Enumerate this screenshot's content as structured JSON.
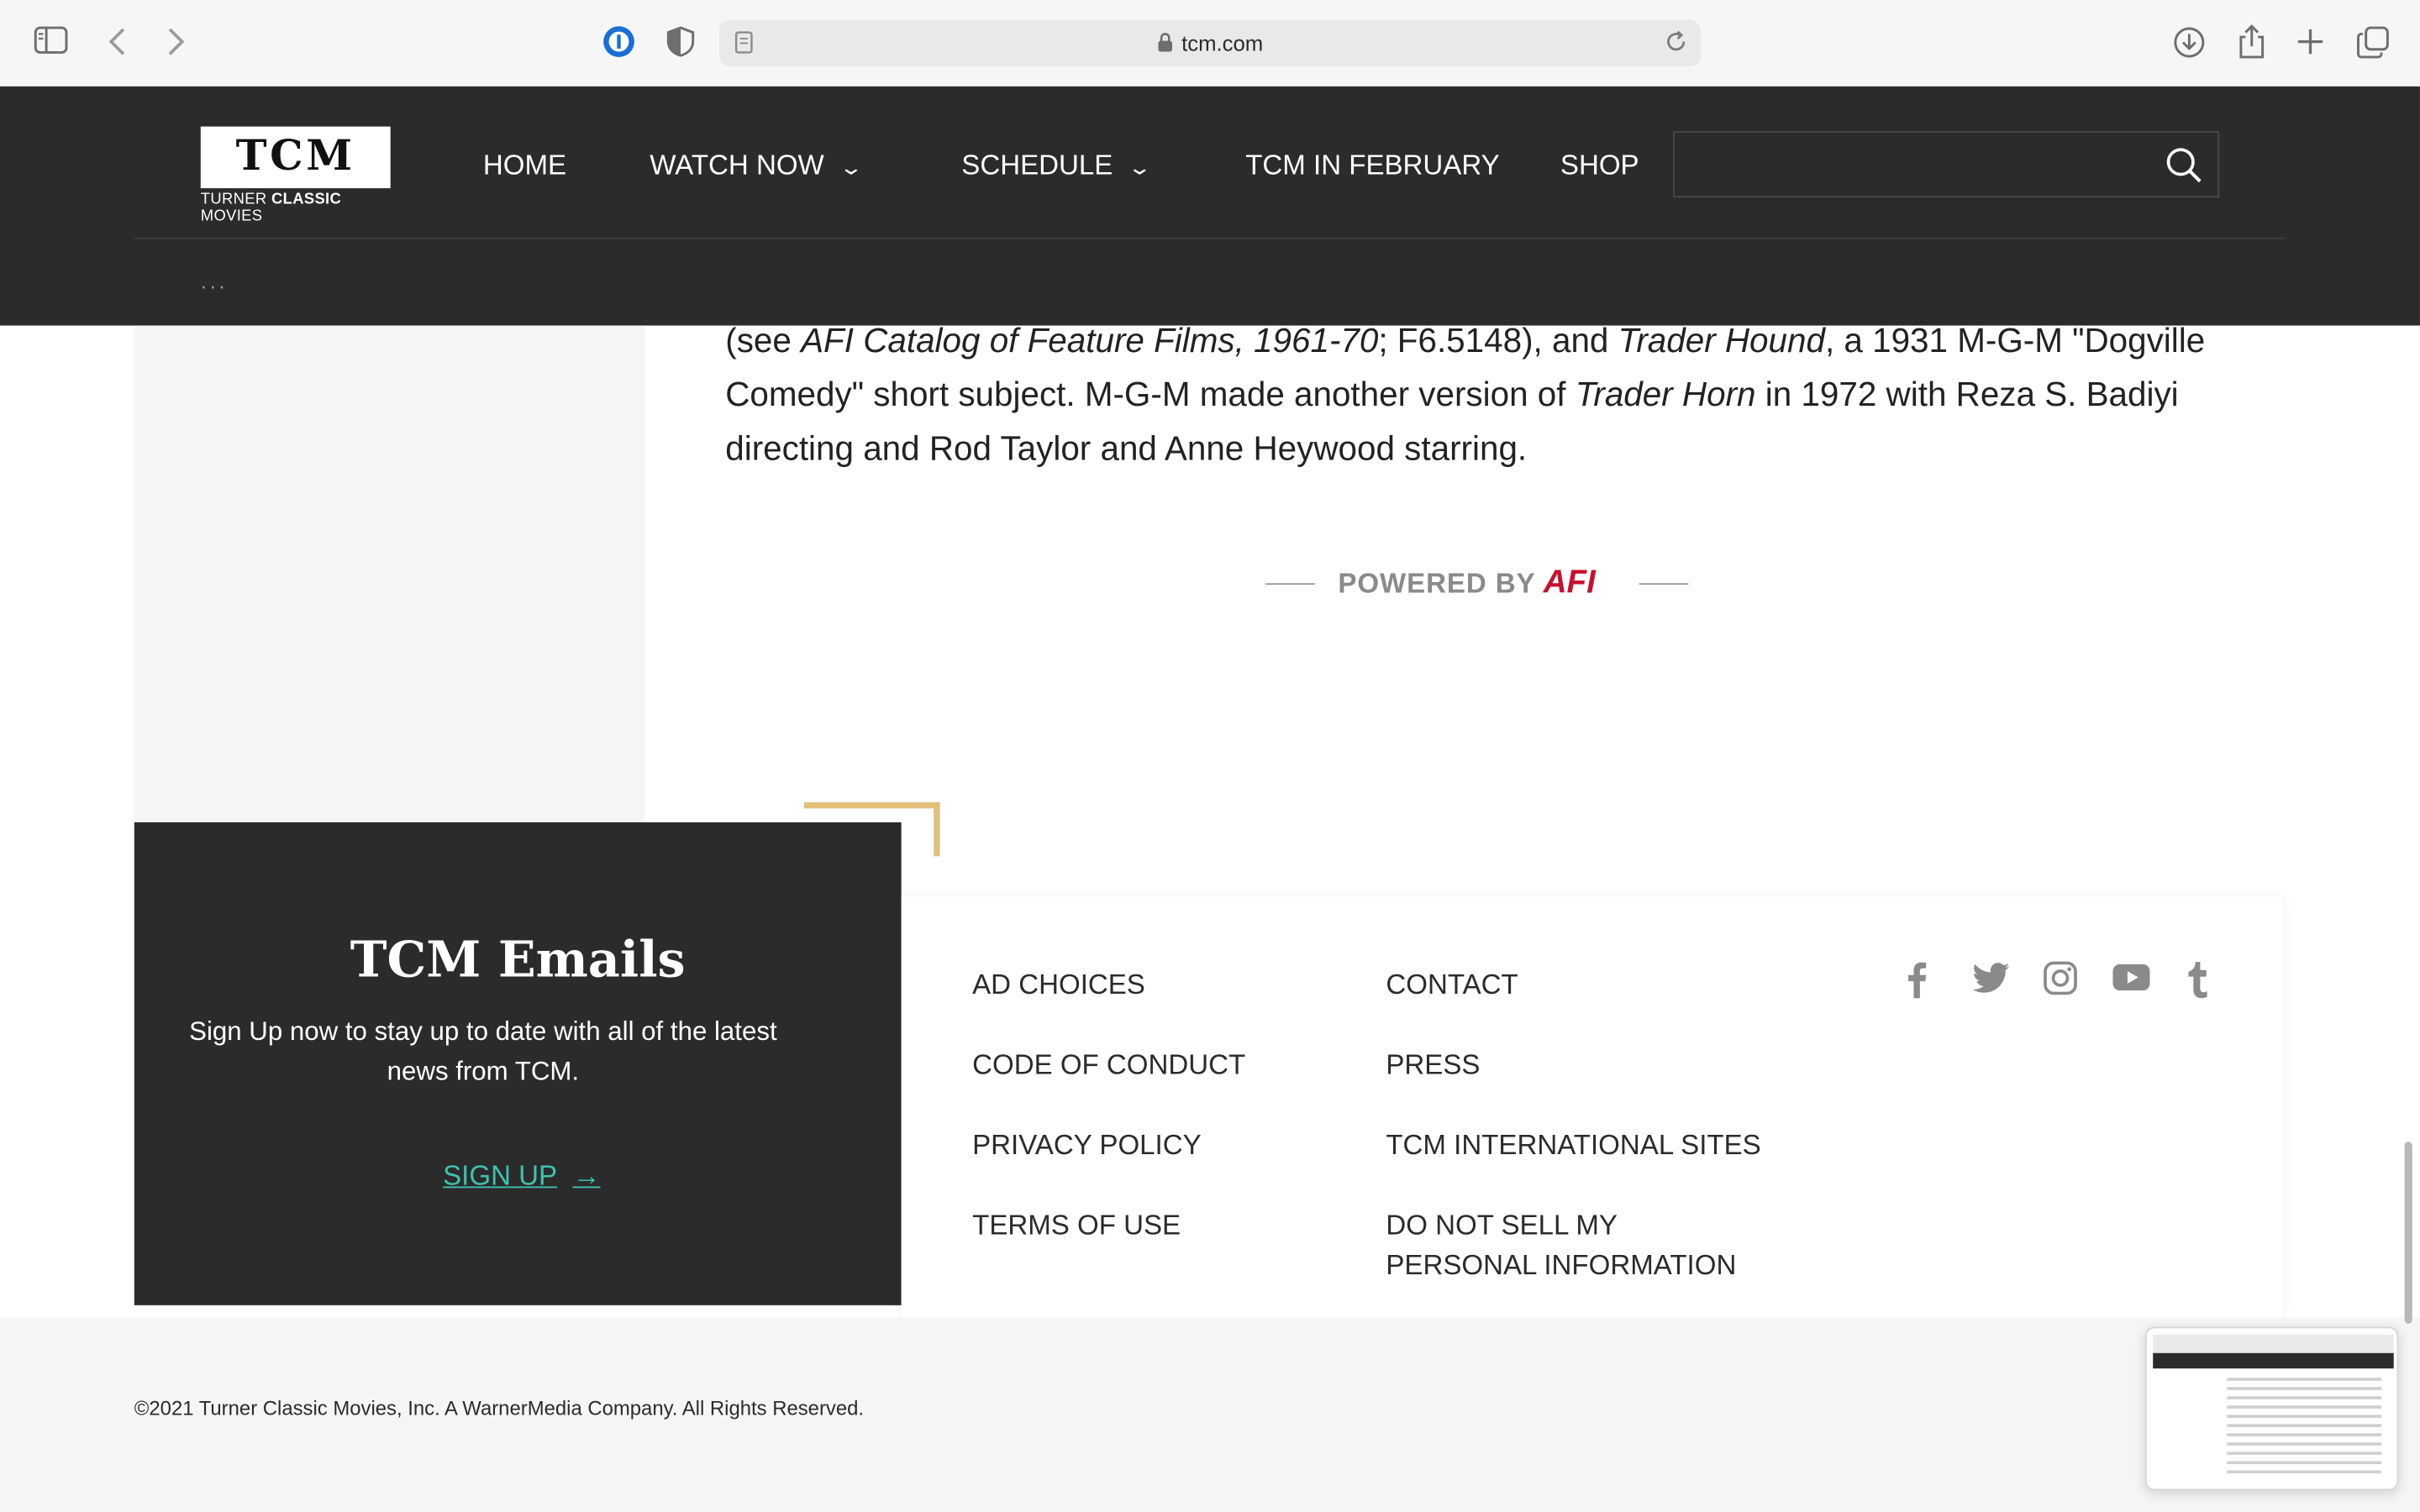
{
  "browser": {
    "url": "tcm.com",
    "icons": [
      "sidebar-icon",
      "back-icon",
      "forward-icon",
      "password-manager-icon",
      "shield-icon",
      "reader-icon",
      "lock-icon",
      "reload-icon",
      "download-icon",
      "share-icon",
      "new-tab-icon",
      "tabs-overview-icon"
    ]
  },
  "header": {
    "logo_text": "TCM",
    "logo_sub_prefix": "TURNER ",
    "logo_sub_bold": "CLASSIC",
    "logo_sub_suffix": " MOVIES",
    "nav": {
      "home": "HOME",
      "watch_now": "WATCH NOW",
      "schedule": "SCHEDULE",
      "tcm_in_february": "TCM IN FEBRUARY",
      "shop": "SHOP"
    },
    "search_value": "",
    "breadcrumb": "..."
  },
  "article": {
    "p1": "(see ",
    "p1_i1": "AFI Catalog of Feature Films, 1961-70",
    "p1_2": "; F6.5148), and ",
    "p1_i2": "Trader Hound",
    "p1_3": ", a 1931 M-G-M \"Dogville Comedy\" short subject. M-G-M made another version of ",
    "p1_i3": "Trader Horn",
    "p1_4": " in 1972 with Reza S. Badiyi directing and Rod Taylor and Anne Heywood starring.",
    "powered_by": "POWERED BY",
    "afi_logo": "AFI"
  },
  "emails": {
    "title": "TCM Emails",
    "text": "Sign Up now to stay up to date with all of the latest news from TCM.",
    "signup": "SIGN UP"
  },
  "footer": {
    "links": {
      "ad_choices": "AD CHOICES",
      "code_of_conduct": "CODE OF CONDUCT",
      "privacy_policy": "PRIVACY POLICY",
      "terms_of_use": "TERMS OF USE",
      "contact": "CONTACT",
      "press": "PRESS",
      "international": "TCM INTERNATIONAL SITES",
      "do_not_sell": "DO NOT SELL MY PERSONAL INFORMATION"
    },
    "social": [
      "facebook-icon",
      "twitter-icon",
      "instagram-icon",
      "youtube-icon",
      "tumblr-icon"
    ],
    "copyright": "©2021 Turner Classic Movies, Inc. A WarnerMedia Company. All Rights Reserved."
  },
  "colors": {
    "header_bg": "#2b2b2b",
    "accent_teal": "#3fc1b0",
    "accent_gold": "#e2c07a",
    "afi_red": "#c8102e"
  }
}
